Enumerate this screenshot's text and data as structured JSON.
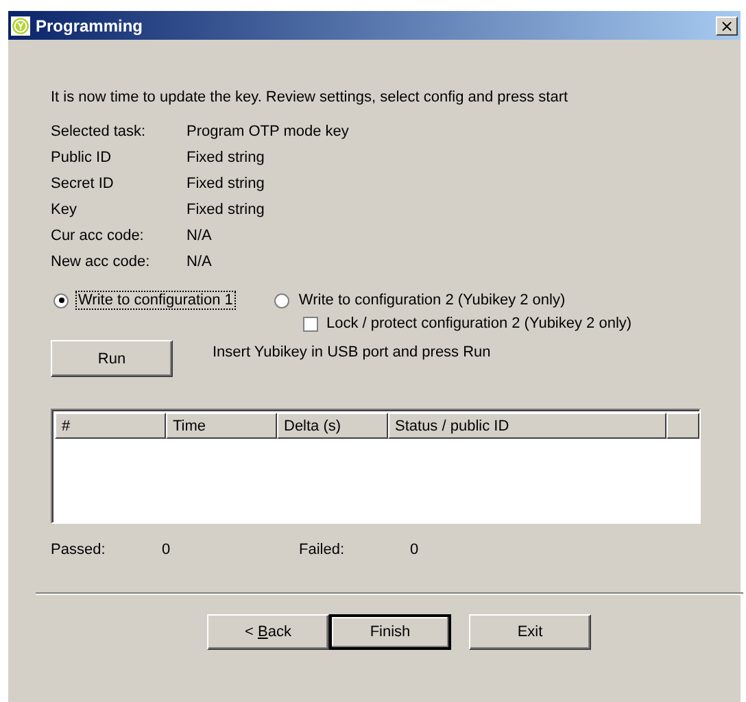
{
  "window": {
    "title": "Programming",
    "close": "×"
  },
  "intro": "It is now time to update the key. Review settings, select config and press start",
  "settings": [
    {
      "label": "Selected task:",
      "value": "Program OTP mode key"
    },
    {
      "label": "Public ID",
      "value": "Fixed string"
    },
    {
      "label": "Secret ID",
      "value": "Fixed string"
    },
    {
      "label": "Key",
      "value": "Fixed string"
    },
    {
      "label": "Cur acc code:",
      "value": "N/A"
    },
    {
      "label": "New acc code:",
      "value": "N/A"
    }
  ],
  "config_options": [
    {
      "label": "Write to configuration 1",
      "selected": true,
      "focused": true
    },
    {
      "label": "Write to configuration 2 (Yubikey 2 only)",
      "selected": false,
      "focused": false
    }
  ],
  "lock_option": {
    "label": "Lock / protect configuration 2 (Yubikey 2 only)",
    "checked": false
  },
  "run_button": "Run",
  "run_hint": "Insert Yubikey in USB port and press Run",
  "table": {
    "columns": [
      "#",
      "Time",
      "Delta (s)",
      "Status / public ID"
    ]
  },
  "counters": [
    {
      "label": "Passed:",
      "value": "0"
    },
    {
      "label": "Failed:",
      "value": "0"
    }
  ],
  "buttons": [
    {
      "before": "< ",
      "mnemonic": "B",
      "after": "ack",
      "default": false
    },
    {
      "label": "Finish",
      "default": true
    },
    {
      "label": "Exit",
      "default": false
    }
  ]
}
